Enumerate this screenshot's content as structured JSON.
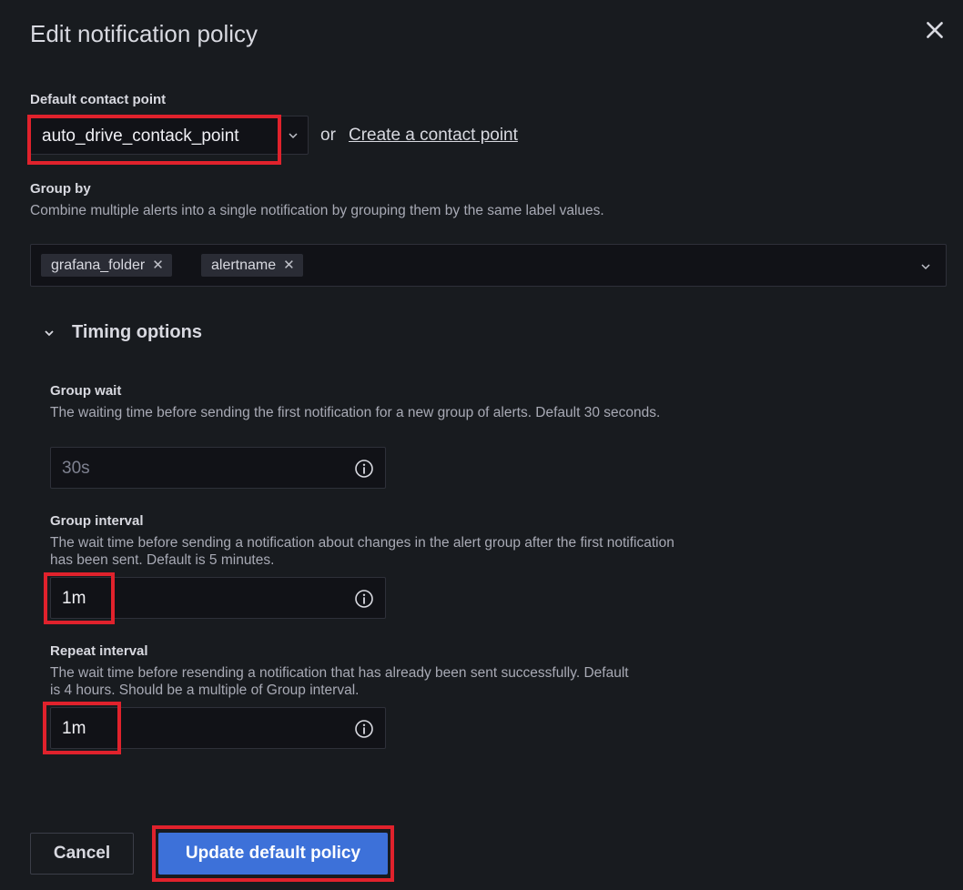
{
  "dialog": {
    "title": "Edit notification policy"
  },
  "contact_point": {
    "label": "Default contact point",
    "selected": "auto_drive_contack_point",
    "or_text": "or",
    "create_link": "Create a contact point"
  },
  "group_by": {
    "label": "Group by",
    "description": "Combine multiple alerts into a single notification by grouping them by the same label values.",
    "chips": [
      {
        "label": "grafana_folder"
      },
      {
        "label": "alertname"
      }
    ]
  },
  "timing": {
    "toggle_label": "Timing options",
    "group_wait": {
      "label": "Group wait",
      "description": "The waiting time before sending the first notification for a new group of alerts. Default 30 seconds.",
      "placeholder": "30s"
    },
    "group_interval": {
      "label": "Group interval",
      "description": "The wait time before sending a notification about changes in the alert group after the first notification has been sent. Default is 5 minutes.",
      "value": "1m"
    },
    "repeat_interval": {
      "label": "Repeat interval",
      "description": "The wait time before resending a notification that has already been sent successfully. Default is 4 hours. Should be a multiple of Group interval.",
      "value": "1m"
    }
  },
  "actions": {
    "cancel": "Cancel",
    "update": "Update default policy"
  },
  "colors": {
    "background": "#181b1f",
    "input_bg": "#111217",
    "primary_button": "#3d71d9",
    "highlight_box": "#e0222c"
  },
  "icons": {
    "close": "close-icon",
    "chevron": "chevron-down-icon",
    "info": "info-icon"
  }
}
